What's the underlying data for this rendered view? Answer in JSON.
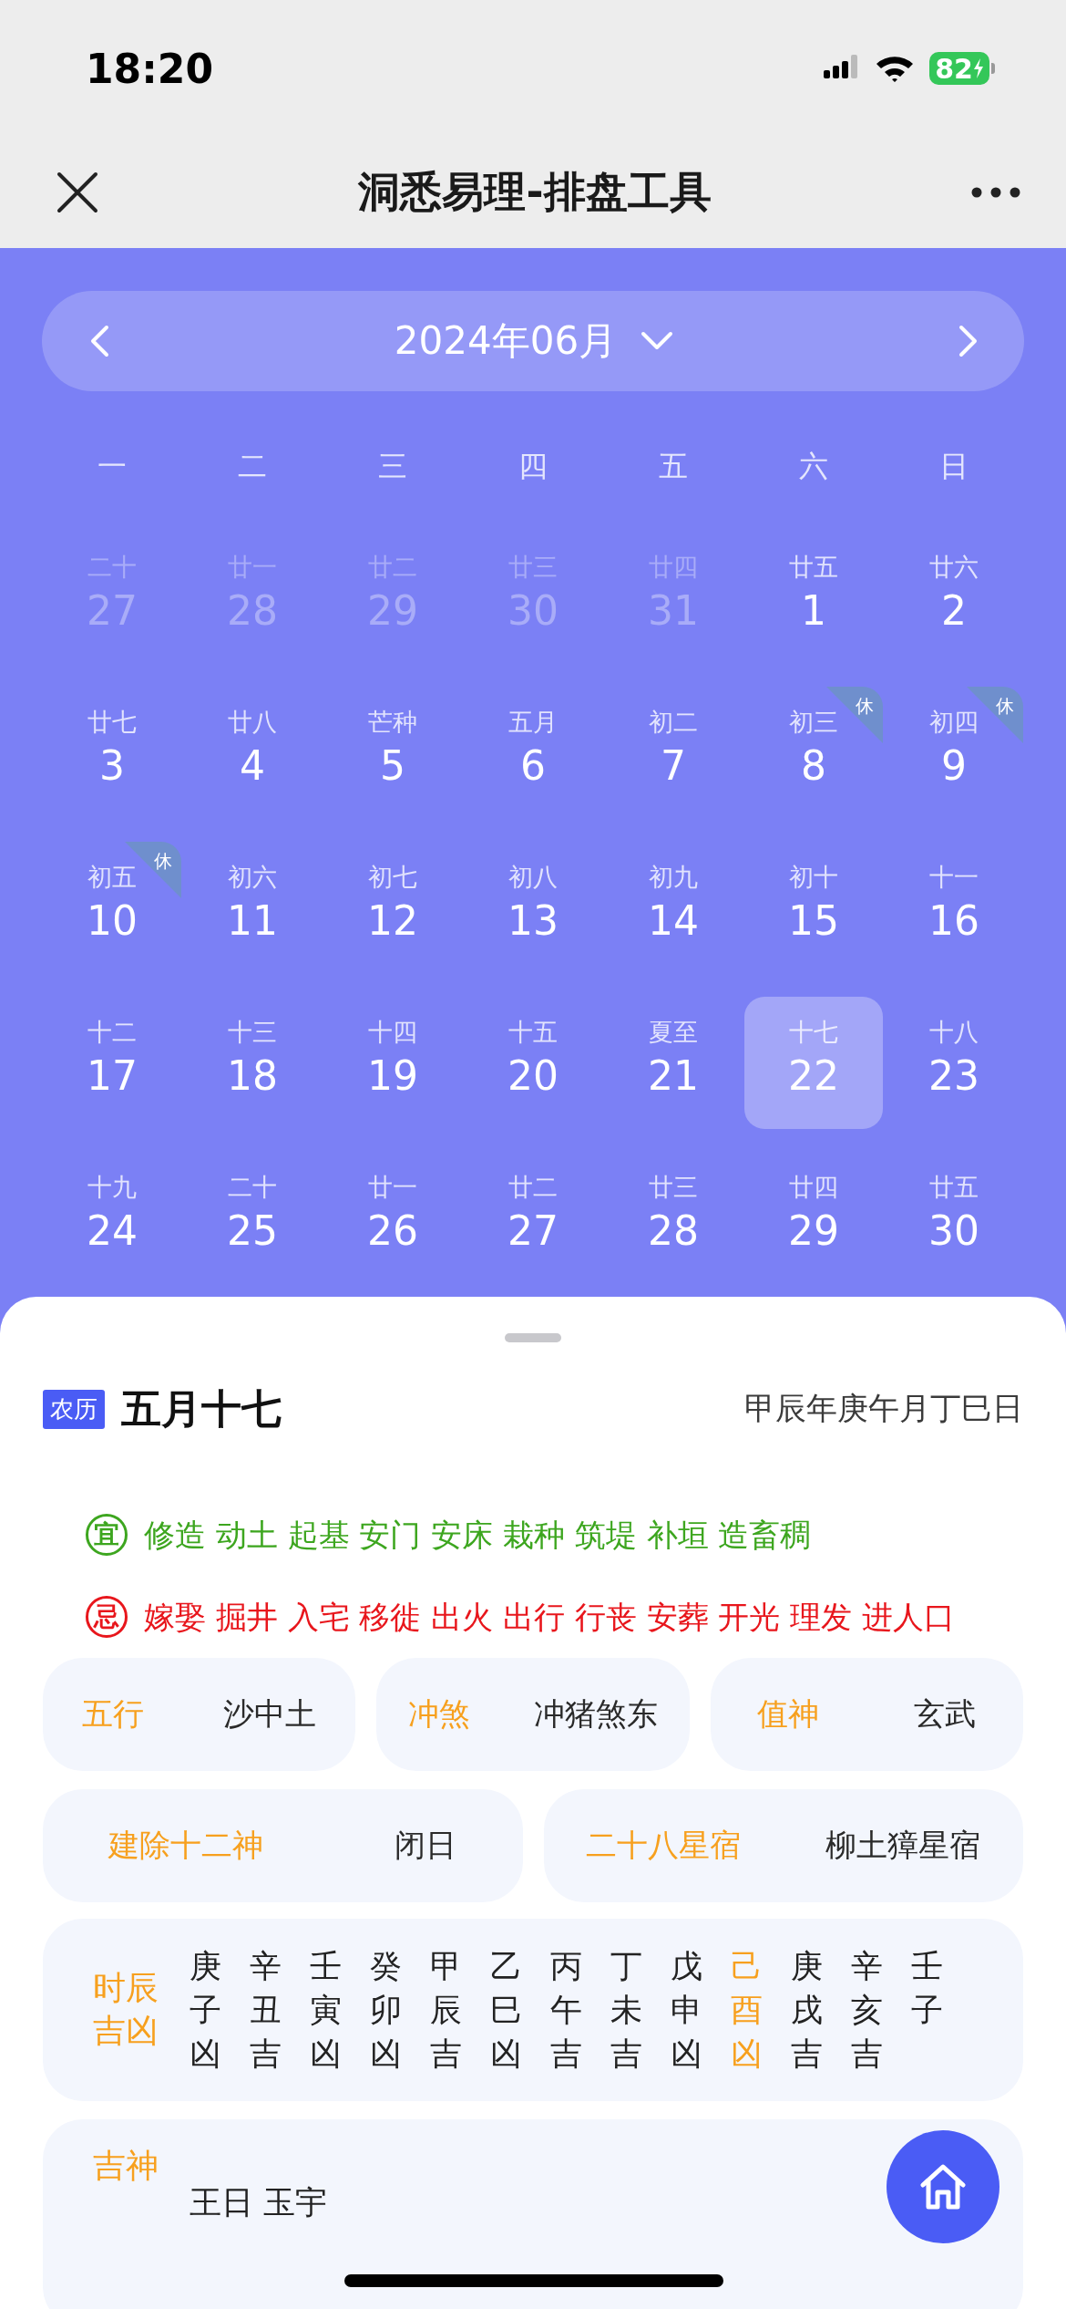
{
  "status_bar": {
    "time": "18:20",
    "battery": "82"
  },
  "nav_bar": {
    "title": "洞悉易理-排盘工具"
  },
  "calendar": {
    "month": "2024年06月",
    "weekdays": [
      "一",
      "二",
      "三",
      "四",
      "五",
      "六",
      "日"
    ],
    "days": [
      {
        "lunar": "二十",
        "day": "27",
        "in_month": false,
        "selected": false
      },
      {
        "lunar": "廿一",
        "day": "28",
        "in_month": false,
        "selected": false
      },
      {
        "lunar": "廿二",
        "day": "29",
        "in_month": false,
        "selected": false
      },
      {
        "lunar": "廿三",
        "day": "30",
        "in_month": false,
        "selected": false
      },
      {
        "lunar": "廿四",
        "day": "31",
        "in_month": false,
        "selected": false
      },
      {
        "lunar": "廿五",
        "day": "1",
        "in_month": true,
        "selected": false
      },
      {
        "lunar": "廿六",
        "day": "2",
        "in_month": true,
        "selected": false
      },
      {
        "lunar": "廿七",
        "day": "3",
        "in_month": true,
        "selected": false
      },
      {
        "lunar": "廿八",
        "day": "4",
        "in_month": true,
        "selected": false
      },
      {
        "lunar": "芒种",
        "day": "5",
        "in_month": true,
        "selected": false
      },
      {
        "lunar": "五月",
        "day": "6",
        "in_month": true,
        "selected": false
      },
      {
        "lunar": "初二",
        "day": "7",
        "in_month": true,
        "selected": false
      },
      {
        "lunar": "初三",
        "day": "8",
        "in_month": true,
        "selected": false,
        "badge": "休"
      },
      {
        "lunar": "初四",
        "day": "9",
        "in_month": true,
        "selected": false,
        "badge": "休"
      },
      {
        "lunar": "初五",
        "day": "10",
        "in_month": true,
        "selected": false,
        "badge": "休"
      },
      {
        "lunar": "初六",
        "day": "11",
        "in_month": true,
        "selected": false
      },
      {
        "lunar": "初七",
        "day": "12",
        "in_month": true,
        "selected": false
      },
      {
        "lunar": "初八",
        "day": "13",
        "in_month": true,
        "selected": false
      },
      {
        "lunar": "初九",
        "day": "14",
        "in_month": true,
        "selected": false
      },
      {
        "lunar": "初十",
        "day": "15",
        "in_month": true,
        "selected": false
      },
      {
        "lunar": "十一",
        "day": "16",
        "in_month": true,
        "selected": false
      },
      {
        "lunar": "十二",
        "day": "17",
        "in_month": true,
        "selected": false
      },
      {
        "lunar": "十三",
        "day": "18",
        "in_month": true,
        "selected": false
      },
      {
        "lunar": "十四",
        "day": "19",
        "in_month": true,
        "selected": false
      },
      {
        "lunar": "十五",
        "day": "20",
        "in_month": true,
        "selected": false
      },
      {
        "lunar": "夏至",
        "day": "21",
        "in_month": true,
        "selected": false
      },
      {
        "lunar": "十七",
        "day": "22",
        "in_month": true,
        "selected": true
      },
      {
        "lunar": "十八",
        "day": "23",
        "in_month": true,
        "selected": false
      },
      {
        "lunar": "十九",
        "day": "24",
        "in_month": true,
        "selected": false
      },
      {
        "lunar": "二十",
        "day": "25",
        "in_month": true,
        "selected": false
      },
      {
        "lunar": "廿一",
        "day": "26",
        "in_month": true,
        "selected": false
      },
      {
        "lunar": "廿二",
        "day": "27",
        "in_month": true,
        "selected": false
      },
      {
        "lunar": "廿三",
        "day": "28",
        "in_month": true,
        "selected": false
      },
      {
        "lunar": "廿四",
        "day": "29",
        "in_month": true,
        "selected": false
      },
      {
        "lunar": "廿五",
        "day": "30",
        "in_month": true,
        "selected": false
      }
    ]
  },
  "detail": {
    "tag": "农历",
    "lunar_date": "五月十七",
    "ganzhi": "甲辰年庚午月丁巳日",
    "advice": [
      {
        "kind": "good",
        "mark": "宜",
        "text": "修造 动土 起基 安门 安床 栽种 筑堤 补垣 造畜稠"
      },
      {
        "kind": "bad",
        "mark": "忌",
        "text": "嫁娶 掘井 入宅 移徙 出火 出行 行丧 安葬 开光 理发 进人口"
      }
    ],
    "info_rows": [
      [
        {
          "label": "五行",
          "value": "沙中土"
        },
        {
          "label": "冲煞",
          "value": "冲猪煞东"
        },
        {
          "label": "值神",
          "value": "玄武"
        }
      ],
      [
        {
          "label": "建除十二神",
          "value": "闭日"
        },
        {
          "label": "二十八星宿",
          "value": "柳土獐星宿"
        }
      ]
    ],
    "hours": {
      "label": "时辰吉凶",
      "items": [
        {
          "stem": "庚",
          "branch": "子",
          "verdict": "凶",
          "selected": false
        },
        {
          "stem": "辛",
          "branch": "丑",
          "verdict": "吉",
          "selected": false
        },
        {
          "stem": "壬",
          "branch": "寅",
          "verdict": "凶",
          "selected": false
        },
        {
          "stem": "癸",
          "branch": "卯",
          "verdict": "凶",
          "selected": false
        },
        {
          "stem": "甲",
          "branch": "辰",
          "verdict": "吉",
          "selected": false
        },
        {
          "stem": "乙",
          "branch": "巳",
          "verdict": "凶",
          "selected": false
        },
        {
          "stem": "丙",
          "branch": "午",
          "verdict": "吉",
          "selected": false
        },
        {
          "stem": "丁",
          "branch": "未",
          "verdict": "吉",
          "selected": false
        },
        {
          "stem": "戊",
          "branch": "申",
          "verdict": "凶",
          "selected": false
        },
        {
          "stem": "己",
          "branch": "酉",
          "verdict": "凶",
          "selected": true
        },
        {
          "stem": "庚",
          "branch": "戌",
          "verdict": "吉",
          "selected": false
        },
        {
          "stem": "辛",
          "branch": "亥",
          "verdict": "吉",
          "selected": false
        },
        {
          "stem": "壬",
          "branch": "子",
          "selected": false
        }
      ]
    },
    "gods": {
      "label": "吉神",
      "value": "王日 玉宇"
    }
  }
}
